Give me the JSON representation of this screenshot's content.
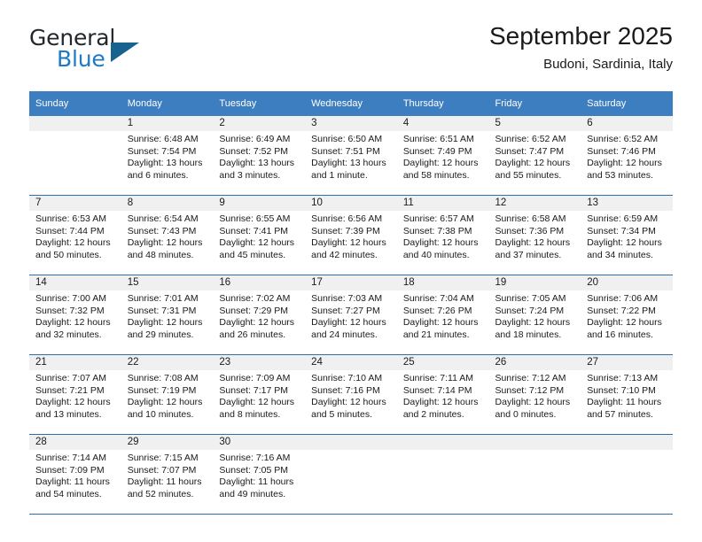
{
  "brand": {
    "name_part1": "General",
    "name_part2": "Blue",
    "logo_icon": "triangle-logo-icon"
  },
  "header": {
    "month_title": "September 2025",
    "location": "Budoni, Sardinia, Italy"
  },
  "theme": {
    "header_blue": "#3c7ebf",
    "border_blue": "#2f6ea8",
    "daynum_band": "#f0f0f0",
    "brand_blue": "#1f7ac6",
    "brand_dark": "#22282c",
    "text": "#1a1a1a"
  },
  "weekday_headers": [
    "Sunday",
    "Monday",
    "Tuesday",
    "Wednesday",
    "Thursday",
    "Friday",
    "Saturday"
  ],
  "labels": {
    "sunrise_prefix": "Sunrise:",
    "sunset_prefix": "Sunset:",
    "daylight_prefix": "Daylight:"
  },
  "weeks": [
    [
      {
        "day": "",
        "empty": true
      },
      {
        "day": "1",
        "sunrise": "Sunrise: 6:48 AM",
        "sunset": "Sunset: 7:54 PM",
        "daylight": "Daylight: 13 hours and 6 minutes."
      },
      {
        "day": "2",
        "sunrise": "Sunrise: 6:49 AM",
        "sunset": "Sunset: 7:52 PM",
        "daylight": "Daylight: 13 hours and 3 minutes."
      },
      {
        "day": "3",
        "sunrise": "Sunrise: 6:50 AM",
        "sunset": "Sunset: 7:51 PM",
        "daylight": "Daylight: 13 hours and 1 minute."
      },
      {
        "day": "4",
        "sunrise": "Sunrise: 6:51 AM",
        "sunset": "Sunset: 7:49 PM",
        "daylight": "Daylight: 12 hours and 58 minutes."
      },
      {
        "day": "5",
        "sunrise": "Sunrise: 6:52 AM",
        "sunset": "Sunset: 7:47 PM",
        "daylight": "Daylight: 12 hours and 55 minutes."
      },
      {
        "day": "6",
        "sunrise": "Sunrise: 6:52 AM",
        "sunset": "Sunset: 7:46 PM",
        "daylight": "Daylight: 12 hours and 53 minutes."
      }
    ],
    [
      {
        "day": "7",
        "sunrise": "Sunrise: 6:53 AM",
        "sunset": "Sunset: 7:44 PM",
        "daylight": "Daylight: 12 hours and 50 minutes."
      },
      {
        "day": "8",
        "sunrise": "Sunrise: 6:54 AM",
        "sunset": "Sunset: 7:43 PM",
        "daylight": "Daylight: 12 hours and 48 minutes."
      },
      {
        "day": "9",
        "sunrise": "Sunrise: 6:55 AM",
        "sunset": "Sunset: 7:41 PM",
        "daylight": "Daylight: 12 hours and 45 minutes."
      },
      {
        "day": "10",
        "sunrise": "Sunrise: 6:56 AM",
        "sunset": "Sunset: 7:39 PM",
        "daylight": "Daylight: 12 hours and 42 minutes."
      },
      {
        "day": "11",
        "sunrise": "Sunrise: 6:57 AM",
        "sunset": "Sunset: 7:38 PM",
        "daylight": "Daylight: 12 hours and 40 minutes."
      },
      {
        "day": "12",
        "sunrise": "Sunrise: 6:58 AM",
        "sunset": "Sunset: 7:36 PM",
        "daylight": "Daylight: 12 hours and 37 minutes."
      },
      {
        "day": "13",
        "sunrise": "Sunrise: 6:59 AM",
        "sunset": "Sunset: 7:34 PM",
        "daylight": "Daylight: 12 hours and 34 minutes."
      }
    ],
    [
      {
        "day": "14",
        "sunrise": "Sunrise: 7:00 AM",
        "sunset": "Sunset: 7:32 PM",
        "daylight": "Daylight: 12 hours and 32 minutes."
      },
      {
        "day": "15",
        "sunrise": "Sunrise: 7:01 AM",
        "sunset": "Sunset: 7:31 PM",
        "daylight": "Daylight: 12 hours and 29 minutes."
      },
      {
        "day": "16",
        "sunrise": "Sunrise: 7:02 AM",
        "sunset": "Sunset: 7:29 PM",
        "daylight": "Daylight: 12 hours and 26 minutes."
      },
      {
        "day": "17",
        "sunrise": "Sunrise: 7:03 AM",
        "sunset": "Sunset: 7:27 PM",
        "daylight": "Daylight: 12 hours and 24 minutes."
      },
      {
        "day": "18",
        "sunrise": "Sunrise: 7:04 AM",
        "sunset": "Sunset: 7:26 PM",
        "daylight": "Daylight: 12 hours and 21 minutes."
      },
      {
        "day": "19",
        "sunrise": "Sunrise: 7:05 AM",
        "sunset": "Sunset: 7:24 PM",
        "daylight": "Daylight: 12 hours and 18 minutes."
      },
      {
        "day": "20",
        "sunrise": "Sunrise: 7:06 AM",
        "sunset": "Sunset: 7:22 PM",
        "daylight": "Daylight: 12 hours and 16 minutes."
      }
    ],
    [
      {
        "day": "21",
        "sunrise": "Sunrise: 7:07 AM",
        "sunset": "Sunset: 7:21 PM",
        "daylight": "Daylight: 12 hours and 13 minutes."
      },
      {
        "day": "22",
        "sunrise": "Sunrise: 7:08 AM",
        "sunset": "Sunset: 7:19 PM",
        "daylight": "Daylight: 12 hours and 10 minutes."
      },
      {
        "day": "23",
        "sunrise": "Sunrise: 7:09 AM",
        "sunset": "Sunset: 7:17 PM",
        "daylight": "Daylight: 12 hours and 8 minutes."
      },
      {
        "day": "24",
        "sunrise": "Sunrise: 7:10 AM",
        "sunset": "Sunset: 7:16 PM",
        "daylight": "Daylight: 12 hours and 5 minutes."
      },
      {
        "day": "25",
        "sunrise": "Sunrise: 7:11 AM",
        "sunset": "Sunset: 7:14 PM",
        "daylight": "Daylight: 12 hours and 2 minutes."
      },
      {
        "day": "26",
        "sunrise": "Sunrise: 7:12 AM",
        "sunset": "Sunset: 7:12 PM",
        "daylight": "Daylight: 12 hours and 0 minutes."
      },
      {
        "day": "27",
        "sunrise": "Sunrise: 7:13 AM",
        "sunset": "Sunset: 7:10 PM",
        "daylight": "Daylight: 11 hours and 57 minutes."
      }
    ],
    [
      {
        "day": "28",
        "sunrise": "Sunrise: 7:14 AM",
        "sunset": "Sunset: 7:09 PM",
        "daylight": "Daylight: 11 hours and 54 minutes."
      },
      {
        "day": "29",
        "sunrise": "Sunrise: 7:15 AM",
        "sunset": "Sunset: 7:07 PM",
        "daylight": "Daylight: 11 hours and 52 minutes."
      },
      {
        "day": "30",
        "sunrise": "Sunrise: 7:16 AM",
        "sunset": "Sunset: 7:05 PM",
        "daylight": "Daylight: 11 hours and 49 minutes."
      },
      {
        "day": "",
        "empty": true
      },
      {
        "day": "",
        "empty": true
      },
      {
        "day": "",
        "empty": true
      },
      {
        "day": "",
        "empty": true
      }
    ]
  ]
}
